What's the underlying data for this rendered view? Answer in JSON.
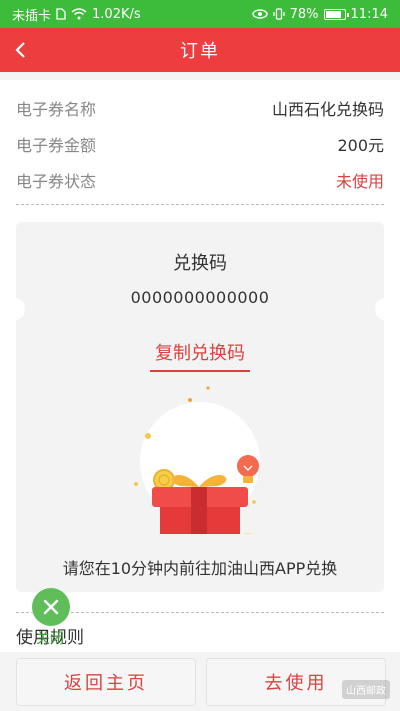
{
  "status_bar": {
    "carrier": "未插卡",
    "speed": "1.02K/s",
    "battery_percent": "78%",
    "time": "11:14"
  },
  "header": {
    "title": "订单",
    "back_icon": "chevron-left-icon"
  },
  "info": {
    "rows": [
      {
        "label": "电子券名称",
        "value": "山西石化兑换码"
      },
      {
        "label": "电子券金额",
        "value": "200元"
      },
      {
        "label": "电子券状态",
        "value": "未使用"
      }
    ]
  },
  "voucher": {
    "code_title": "兑换码",
    "code_value": "0000000000000",
    "copy_label": "复制兑换码",
    "instruction": "请您在10分钟内前往加油山西APP兑换"
  },
  "rules": {
    "label": "使用规则"
  },
  "close_overlay": {
    "label": "关闭"
  },
  "actions": {
    "home_label": "返回主页",
    "use_label": "去使用"
  },
  "watermark": "山西邮政",
  "colors": {
    "status_bar": "#3dbb3a",
    "header": "#ee3d3f",
    "accent_red": "#d9433f",
    "close_green": "#5fbe5a"
  }
}
